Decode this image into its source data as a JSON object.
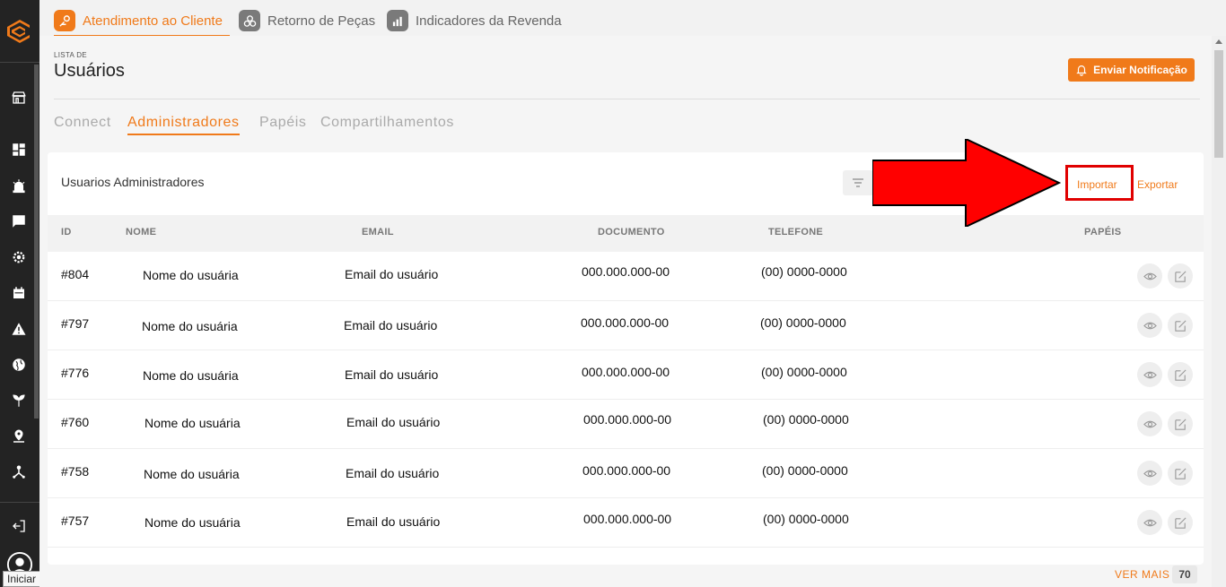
{
  "top_tabs": [
    {
      "label": "Atendimento ao Cliente",
      "icon": "service-icon",
      "active": true
    },
    {
      "label": "Retorno de Peças",
      "icon": "parts-icon",
      "active": false
    },
    {
      "label": "Indicadores da Revenda",
      "icon": "chart-icon",
      "active": false
    }
  ],
  "header": {
    "eyebrow": "LISTA DE",
    "title": "Usuários",
    "notify_label": "Enviar Notificação"
  },
  "sub_tabs": [
    {
      "label": "Connect",
      "active": false
    },
    {
      "label": "Administradores",
      "active": true
    },
    {
      "label": "Papéis",
      "active": false
    },
    {
      "label": "Compartilhamentos",
      "active": false
    }
  ],
  "card": {
    "title": "Usuarios Administradores",
    "import_label": "Importar",
    "export_label": "Exportar"
  },
  "table": {
    "columns": [
      "ID",
      "NOME",
      "EMAIL",
      "DOCUMENTO",
      "TELEFONE",
      "PAPÉIS"
    ],
    "rows": [
      {
        "id": "#804",
        "nome": "Nome do usuária",
        "email": "Email do usuário",
        "documento": "000.000.000-00",
        "telefone": "(00) 0000-0000"
      },
      {
        "id": "#797",
        "nome": "Nome do usuária",
        "email": "Email do usuário",
        "documento": "000.000.000-00",
        "telefone": "(00) 0000-0000"
      },
      {
        "id": "#776",
        "nome": "Nome do usuária",
        "email": "Email do usuário",
        "documento": "000.000.000-00",
        "telefone": "(00) 0000-0000"
      },
      {
        "id": "#760",
        "nome": "Nome do usuária",
        "email": "Email do usuário",
        "documento": "000.000.000-00",
        "telefone": "(00) 0000-0000"
      },
      {
        "id": "#758",
        "nome": "Nome do usuária",
        "email": "Email do usuário",
        "documento": "000.000.000-00",
        "telefone": "(00) 0000-0000"
      },
      {
        "id": "#757",
        "nome": "Nome do usuária",
        "email": "Email do usuário",
        "documento": "000.000.000-00",
        "telefone": "(00) 0000-0000"
      }
    ]
  },
  "footer": {
    "ver_mais": "VER MAIS",
    "count": "70"
  },
  "tooltip": "Iniciar",
  "colors": {
    "accent": "#f07a1a",
    "sidebar": "#232323",
    "annotation": "#e00000"
  }
}
